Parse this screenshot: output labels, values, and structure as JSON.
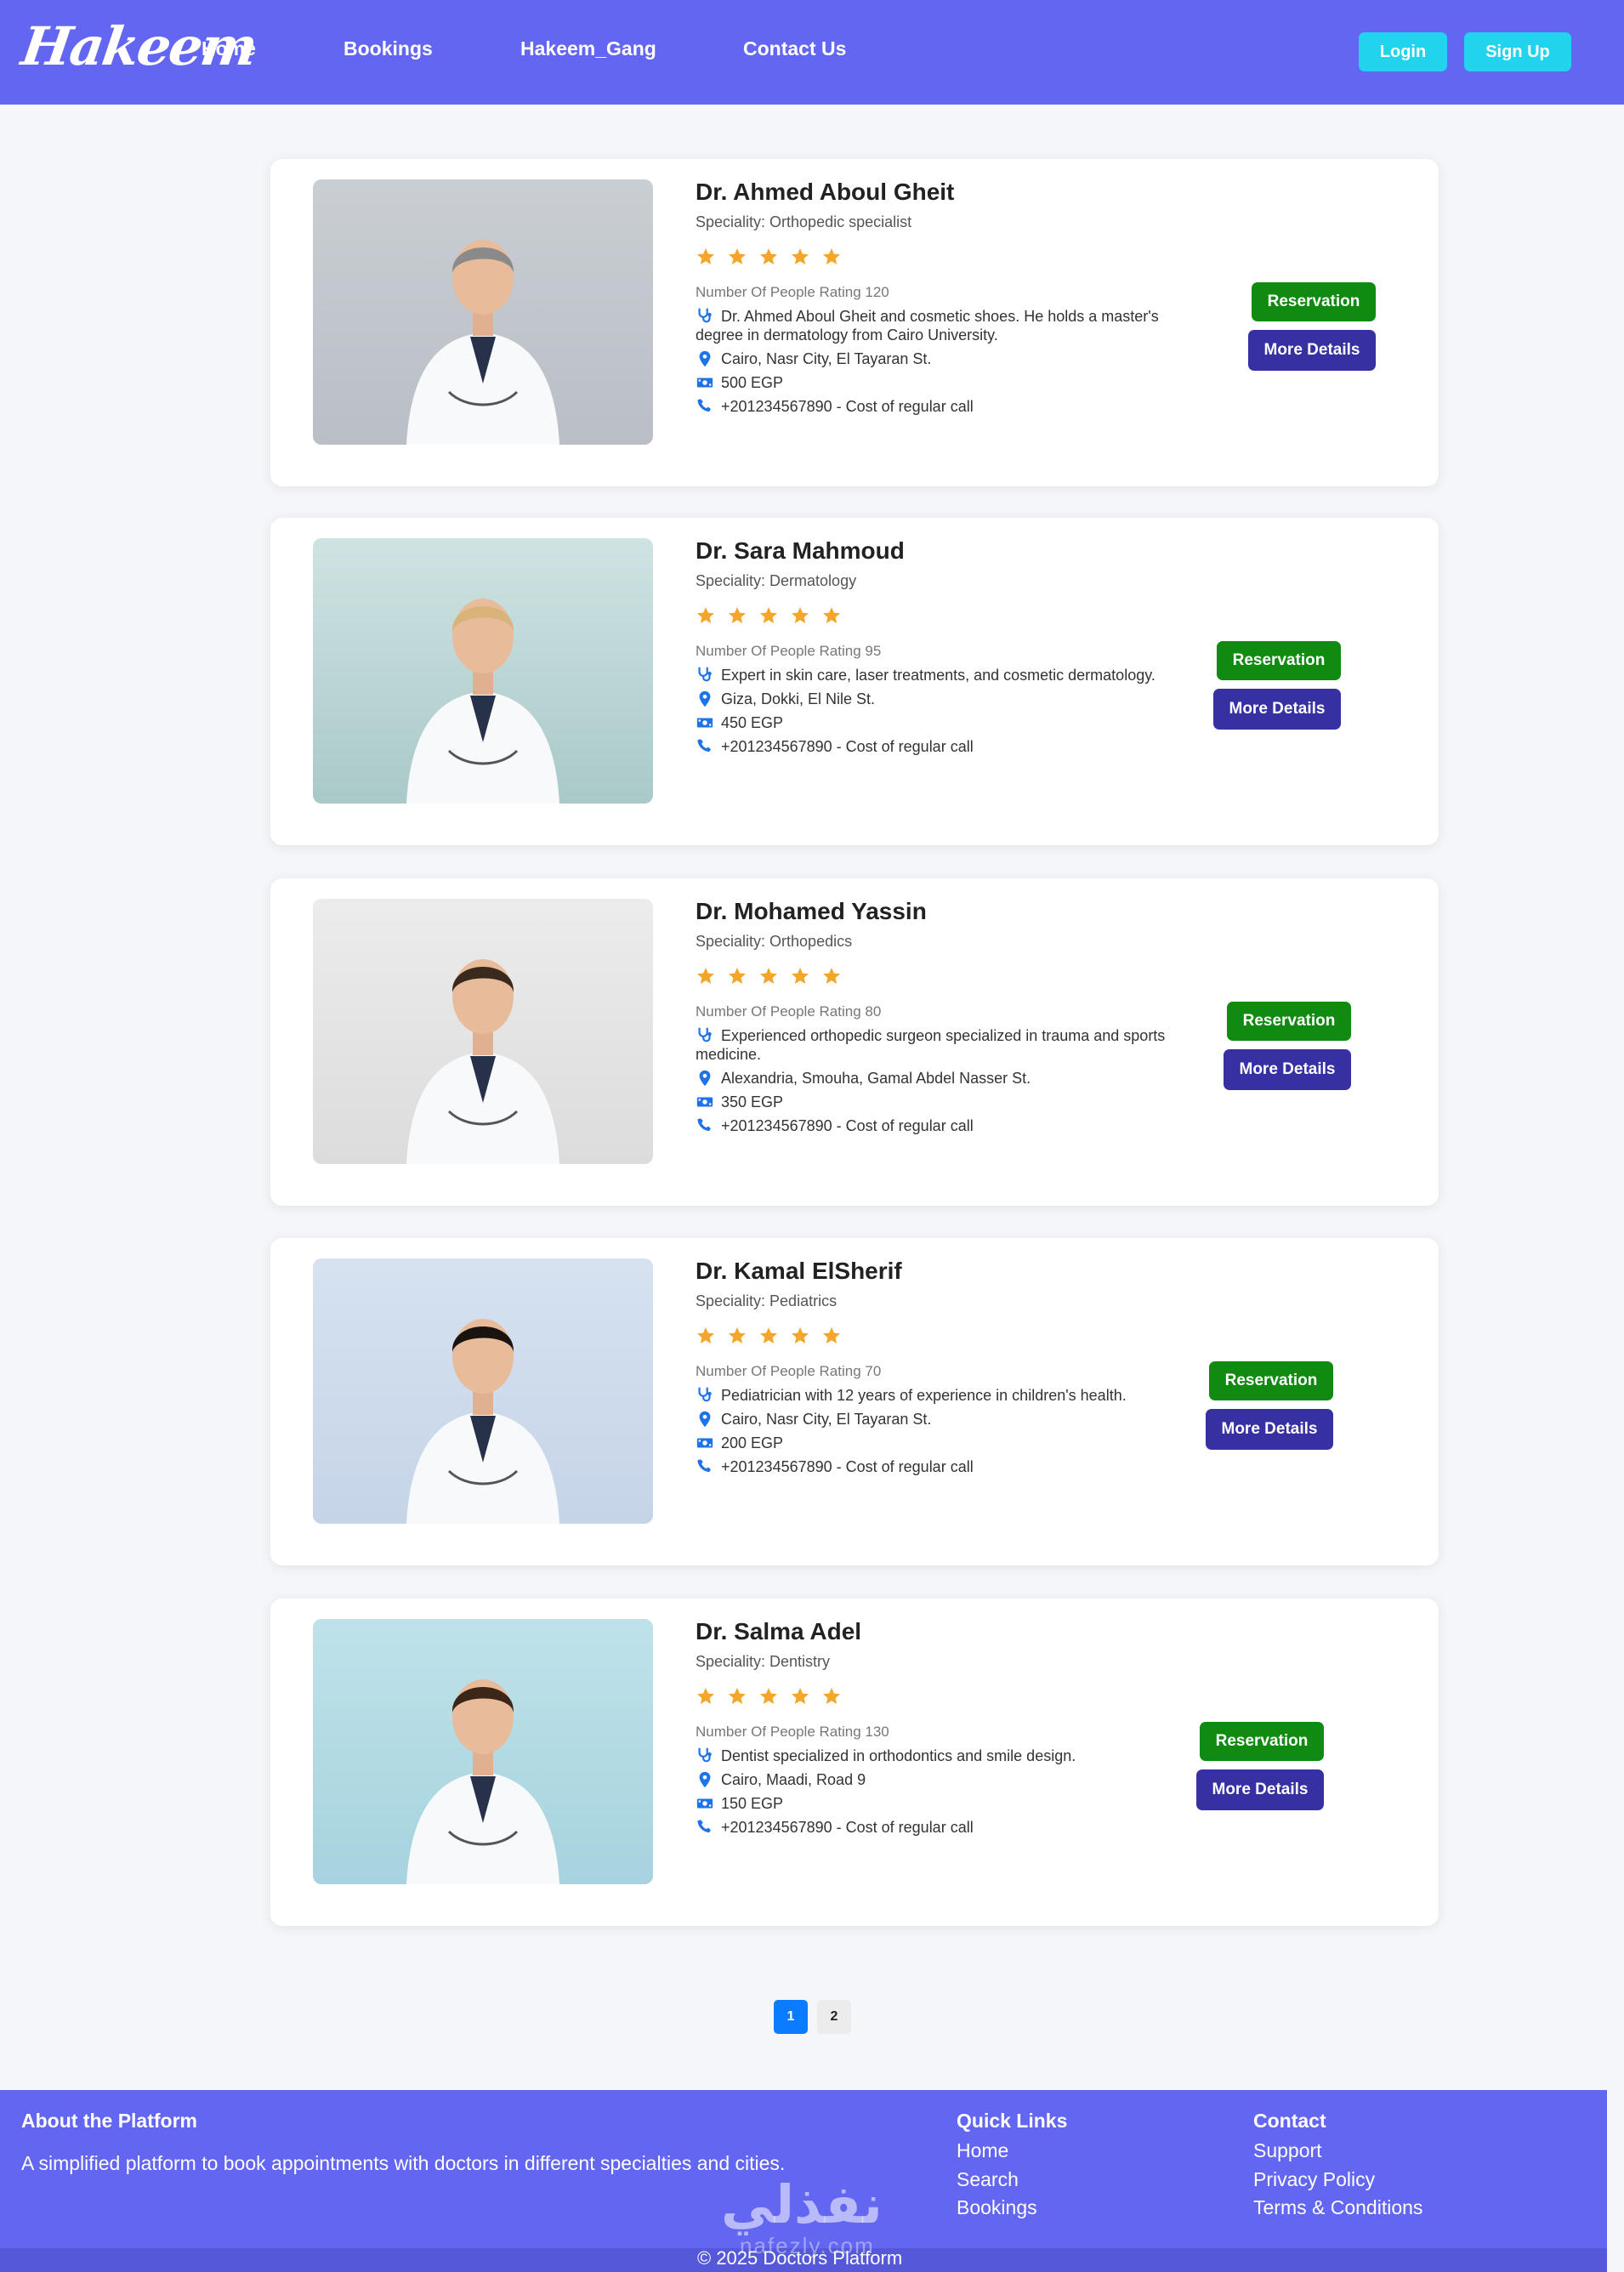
{
  "nav": {
    "logo": "Hakeem",
    "links": [
      "Home",
      "Bookings",
      "Hakeem_Gang",
      "Contact Us"
    ],
    "login": "Login",
    "signup": "Sign Up"
  },
  "colors": {
    "navbar": "#6366f1",
    "accent_cyan": "#22d3ee",
    "reservation_green": "#108a10",
    "details_indigo": "#3730a3",
    "star_orange": "#f4a62a",
    "icon_blue": "#1e73e8",
    "page_active": "#0a7cff"
  },
  "doctors": [
    {
      "name": "Dr. Ahmed Aboul Gheit",
      "speciality": "Speciality: Orthopedic specialist",
      "stars": 5,
      "rating": "Number Of People Rating 120",
      "description": "Dr. Ahmed Aboul Gheit and cosmetic shoes. He holds a master's degree in dermatology from Cairo University.",
      "location": "Cairo, Nasr City, El Tayaran St.",
      "price": "500 EGP",
      "phone": "+201234567890 - Cost of regular call",
      "reservation": "Reservation",
      "more": "More Details"
    },
    {
      "name": "Dr. Sara Mahmoud",
      "speciality": "Speciality: Dermatology",
      "stars": 5,
      "rating": "Number Of People Rating 95",
      "description": "Expert in skin care, laser treatments, and cosmetic dermatology.",
      "location": "Giza, Dokki, El Nile St.",
      "price": "450 EGP",
      "phone": "+201234567890 - Cost of regular call",
      "reservation": "Reservation",
      "more": "More Details"
    },
    {
      "name": "Dr. Mohamed Yassin",
      "speciality": "Speciality: Orthopedics",
      "stars": 5,
      "rating": "Number Of People Rating 80",
      "description": "Experienced orthopedic surgeon specialized in trauma and sports medicine.",
      "location": "Alexandria, Smouha, Gamal Abdel Nasser St.",
      "price": "350 EGP",
      "phone": "+201234567890 - Cost of regular call",
      "reservation": "Reservation",
      "more": "More Details"
    },
    {
      "name": "Dr. Kamal ElSherif",
      "speciality": "Speciality: Pediatrics",
      "stars": 5,
      "rating": "Number Of People Rating 70",
      "description": "Pediatrician with 12 years of experience in children's health.",
      "location": "Cairo, Nasr City, El Tayaran St.",
      "price": "200 EGP",
      "phone": "+201234567890 - Cost of regular call",
      "reservation": "Reservation",
      "more": "More Details"
    },
    {
      "name": "Dr. Salma Adel",
      "speciality": "Speciality: Dentistry",
      "stars": 5,
      "rating": "Number Of People Rating 130",
      "description": "Dentist specialized in orthodontics and smile design.",
      "location": "Cairo, Maadi, Road 9",
      "price": "150 EGP",
      "phone": "+201234567890 - Cost of regular call",
      "reservation": "Reservation",
      "more": "More Details"
    }
  ],
  "pagination": {
    "pages": [
      "1",
      "2"
    ],
    "current": "1"
  },
  "footer": {
    "about_title": "About the Platform",
    "about_text": "A simplified platform to book appointments with doctors in different specialties and cities.",
    "quick_title": "Quick Links",
    "quick_links": [
      "Home",
      "Search",
      "Bookings"
    ],
    "contact_title": "Contact",
    "contact_links": [
      "Support",
      "Privacy Policy",
      "Terms & Conditions"
    ],
    "copyright": "© 2025 Doctors Platform",
    "watermark": "نفذلي",
    "watermark_sub": "nafezly.com"
  }
}
